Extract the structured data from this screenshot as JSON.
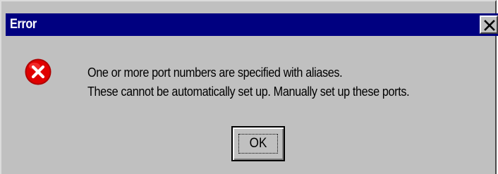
{
  "dialog": {
    "title": "Error",
    "icon": "error-icon",
    "message_lines": [
      "One or more port numbers are specified with aliases.",
      "These cannot be automatically set up.  Manually set up these ports."
    ],
    "ok_label": "OK"
  },
  "colors": {
    "titlebar": "#000080",
    "dialog_background": "#c0c0c0",
    "error_icon_red": "#e00000"
  }
}
